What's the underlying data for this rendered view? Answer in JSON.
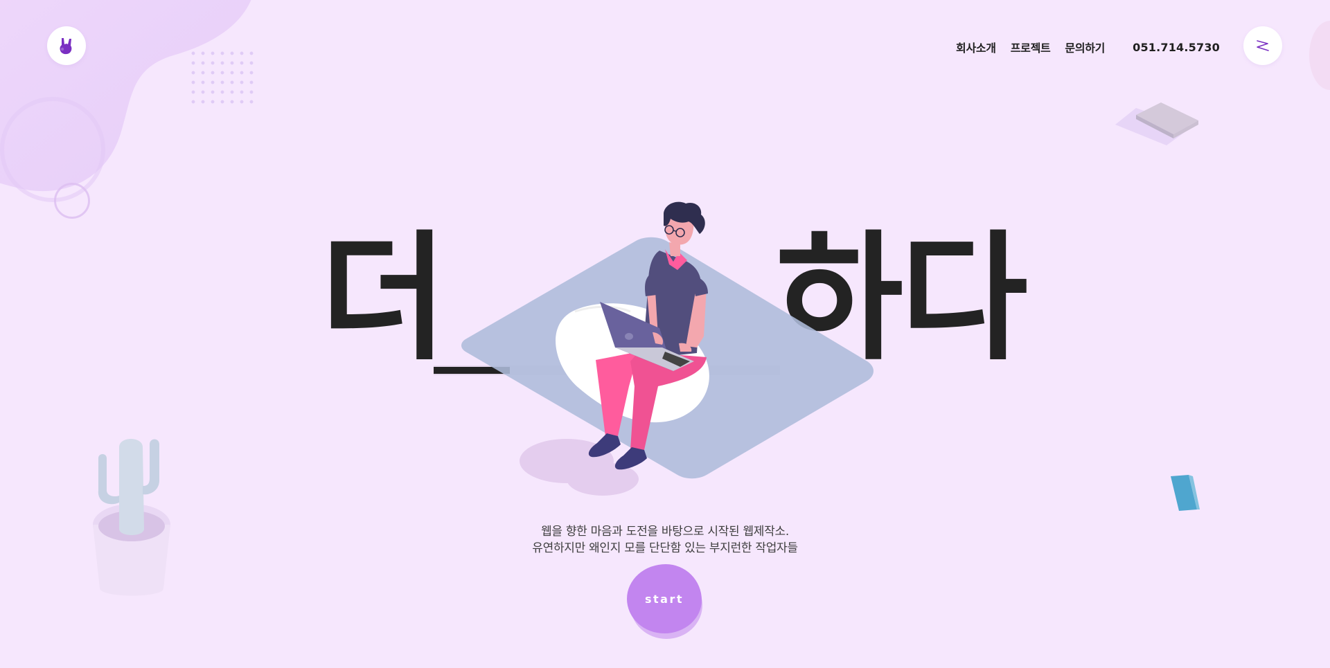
{
  "header": {
    "logo_icon": "rock-hand-icon",
    "nav": [
      {
        "label": "회사소개"
      },
      {
        "label": "프로젝트"
      },
      {
        "label": "문의하기"
      }
    ],
    "phone": "051.714.5730",
    "menu_icon": "zigzag-menu-icon"
  },
  "hero": {
    "word_left": "더",
    "word_right": "하다",
    "illustration": "man-with-laptop-illustration"
  },
  "tagline": {
    "line1": "웹을 향한 마음과 도전을 바탕으로 시작된 웹제작소.",
    "line2": "유연하지만 왜인지 모를 단단함 있는 부지런한 작업자들"
  },
  "cta": {
    "label": "start"
  },
  "colors": {
    "background": "#f6e7fd",
    "accent": "#c285ef",
    "logo": "#7a2fc2",
    "text": "#232323"
  }
}
